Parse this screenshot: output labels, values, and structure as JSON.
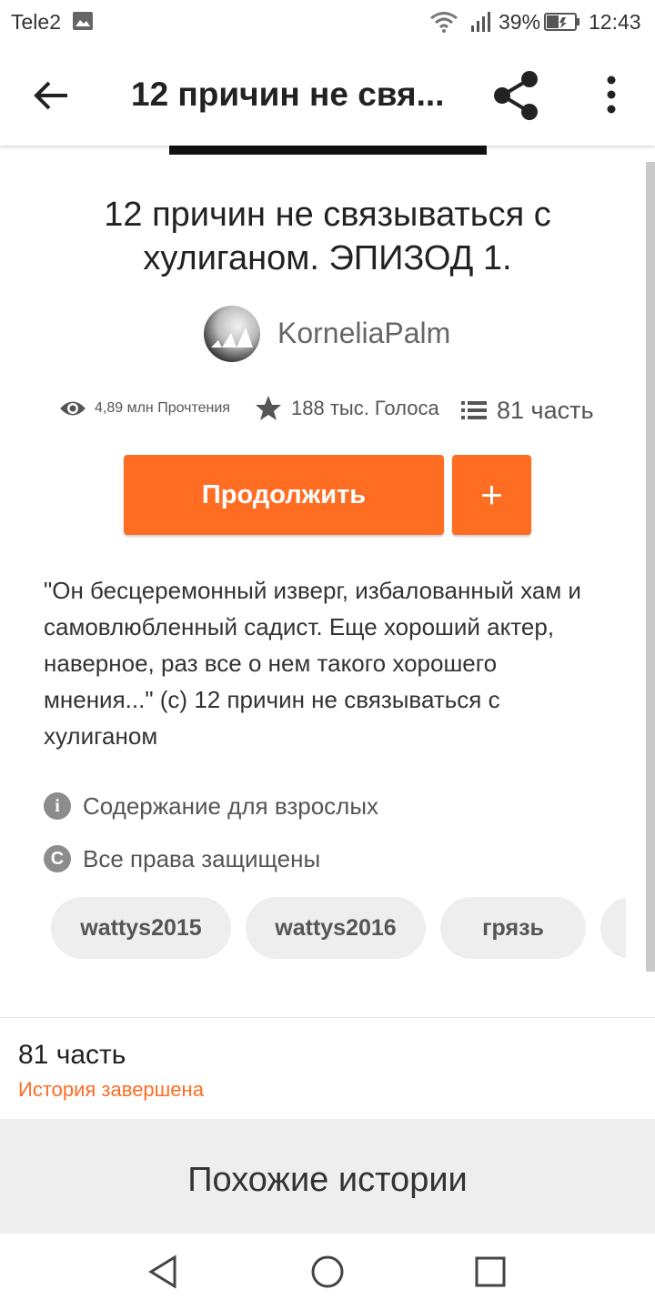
{
  "status_bar": {
    "carrier": "Tele2",
    "battery_percent": "39%",
    "time": "12:43"
  },
  "app_bar": {
    "title": "12 причин не свя...",
    "icons": [
      "back-arrow-icon",
      "share-icon",
      "more-vert-icon"
    ]
  },
  "story": {
    "title": "12 причин не связываться с хулиганом. ЭПИЗОД 1.",
    "author": "KorneliaPalm",
    "stats": {
      "reads": "4,89 млн Прочтения",
      "votes": "188 тыс. Голоса",
      "parts": "81 часть"
    },
    "continue_label": "Продолжить",
    "add_label": "+",
    "description": "\"Он бесцеремонный изверг, избалованный хам и самовлюбленный садист. Еще хороший актер, наверное, раз все о нем такого хорошего мнения...\" (с) 12 причин не связываться с хулиганом",
    "mature": "Содержание для взрослых",
    "copyright": "Все права защищены",
    "tags": [
      "wattys2015",
      "wattys2016",
      "грязь"
    ]
  },
  "parts_section": {
    "count": "81 часть",
    "status": "История завершена"
  },
  "similar": {
    "heading": "Похожие истории"
  },
  "colors": {
    "accent": "#ff6d22",
    "tag_bg": "#eeeeee",
    "section_bg": "#eeeeee"
  }
}
